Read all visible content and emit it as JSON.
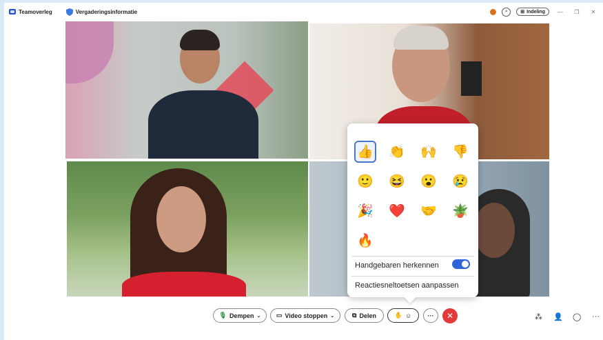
{
  "titlebar": {
    "team_label": "Teamoverleg",
    "info_label": "Vergaderingsinformatie",
    "layout_label": "Indeling"
  },
  "reactions": {
    "emojis": [
      "👍",
      "👏",
      "🙌",
      "👎",
      "🙂",
      "😆",
      "😮",
      "😢",
      "🎉",
      "❤️",
      "🤝",
      "🪴",
      "🔥"
    ],
    "emoji_names": [
      "thumbs-up",
      "clap",
      "raised-hands",
      "thumbs-down",
      "smile",
      "laugh",
      "surprised",
      "sad",
      "party",
      "heart",
      "handshake",
      "plant",
      "fire"
    ],
    "gesture_label": "Handgebaren herkennen",
    "gesture_enabled": true,
    "customize_label": "Reactiesneltoetsen aanpassen"
  },
  "toolbar": {
    "mute_label": "Dempen",
    "video_label": "Video stoppen",
    "share_label": "Delen",
    "more_label": "···"
  },
  "colors": {
    "accent": "#2f64d6",
    "end_call": "#e23a3a",
    "window_bg": "#dbe9f6"
  }
}
